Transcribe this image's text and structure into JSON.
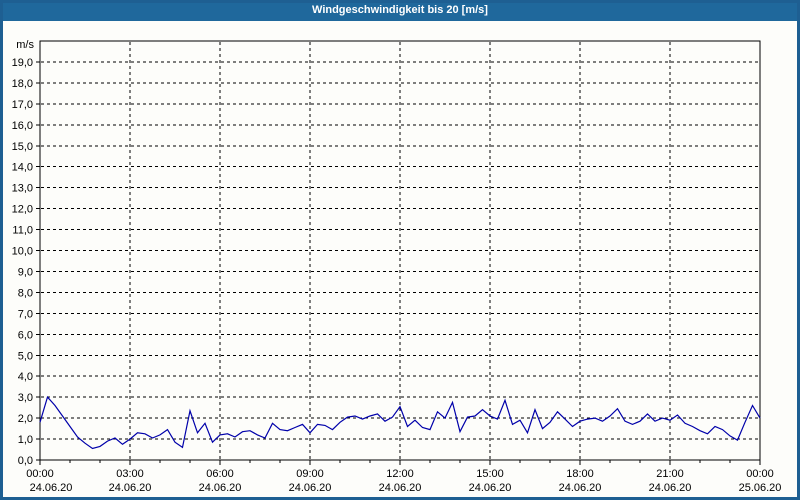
{
  "window": {
    "title": "Windgeschwindigkeit bis 20 [m/s]"
  },
  "colors": {
    "titlebar_bg": "#1f689c",
    "titlebar_text": "#ffffff",
    "frame_border": "#1e5f92",
    "page_bg": "#fdfdfa",
    "plot_border": "#000000",
    "grid": "#000000",
    "tick_label": "#000000",
    "line": "#0000aa"
  },
  "chart_data": {
    "type": "line",
    "title": "Windgeschwindigkeit bis 20 [m/s]",
    "legend": "none",
    "grid": {
      "horizontal_dashed": true,
      "vertical_dashed": true
    },
    "y_axis": {
      "unit_label": "m/s",
      "min": 0,
      "max": 20,
      "tick_step": 1,
      "label_min": 0,
      "label_max": 19,
      "decimal_separator": ",",
      "label_decimals": 1
    },
    "x_axis": {
      "hours_min": 0,
      "hours_max": 24,
      "minor_tick_hours": 1,
      "major_tick_hours": 3,
      "ticks": [
        {
          "hour": 0,
          "time": "00:00",
          "date": "24.06.20"
        },
        {
          "hour": 3,
          "time": "03:00",
          "date": "24.06.20"
        },
        {
          "hour": 6,
          "time": "06:00",
          "date": "24.06.20"
        },
        {
          "hour": 9,
          "time": "09:00",
          "date": "24.06.20"
        },
        {
          "hour": 12,
          "time": "12:00",
          "date": "24.06.20"
        },
        {
          "hour": 15,
          "time": "15:00",
          "date": "24.06.20"
        },
        {
          "hour": 18,
          "time": "18:00",
          "date": "24.06.20"
        },
        {
          "hour": 21,
          "time": "21:00",
          "date": "24.06.20"
        },
        {
          "hour": 24,
          "time": "00:00",
          "date": "25.06.20"
        }
      ]
    },
    "series": [
      {
        "name": "Windgeschwindigkeit",
        "color": "#0000aa",
        "x_start_hour": 0,
        "x_step_hours": 0.25,
        "values": [
          1.8,
          3.0,
          2.6,
          2.1,
          1.6,
          1.1,
          0.8,
          0.55,
          0.65,
          0.9,
          1.05,
          0.75,
          1.0,
          1.3,
          1.25,
          1.05,
          1.2,
          1.45,
          0.85,
          0.6,
          2.35,
          1.3,
          1.75,
          0.85,
          1.2,
          1.25,
          1.1,
          1.35,
          1.4,
          1.2,
          1.05,
          1.75,
          1.45,
          1.4,
          1.55,
          1.7,
          1.3,
          1.7,
          1.65,
          1.45,
          1.8,
          2.05,
          2.1,
          1.95,
          2.1,
          2.2,
          1.85,
          2.05,
          2.55,
          1.6,
          1.9,
          1.55,
          1.45,
          2.3,
          2.0,
          2.75,
          1.35,
          2.05,
          2.1,
          2.4,
          2.1,
          1.95,
          2.85,
          1.7,
          1.9,
          1.3,
          2.4,
          1.5,
          1.8,
          2.3,
          1.95,
          1.6,
          1.85,
          1.95,
          2.0,
          1.85,
          2.1,
          2.45,
          1.85,
          1.7,
          1.85,
          2.2,
          1.85,
          2.0,
          1.9,
          2.15,
          1.75,
          1.6,
          1.4,
          1.25,
          1.6,
          1.45,
          1.15,
          0.95,
          1.8,
          2.6,
          2.0
        ]
      }
    ]
  }
}
